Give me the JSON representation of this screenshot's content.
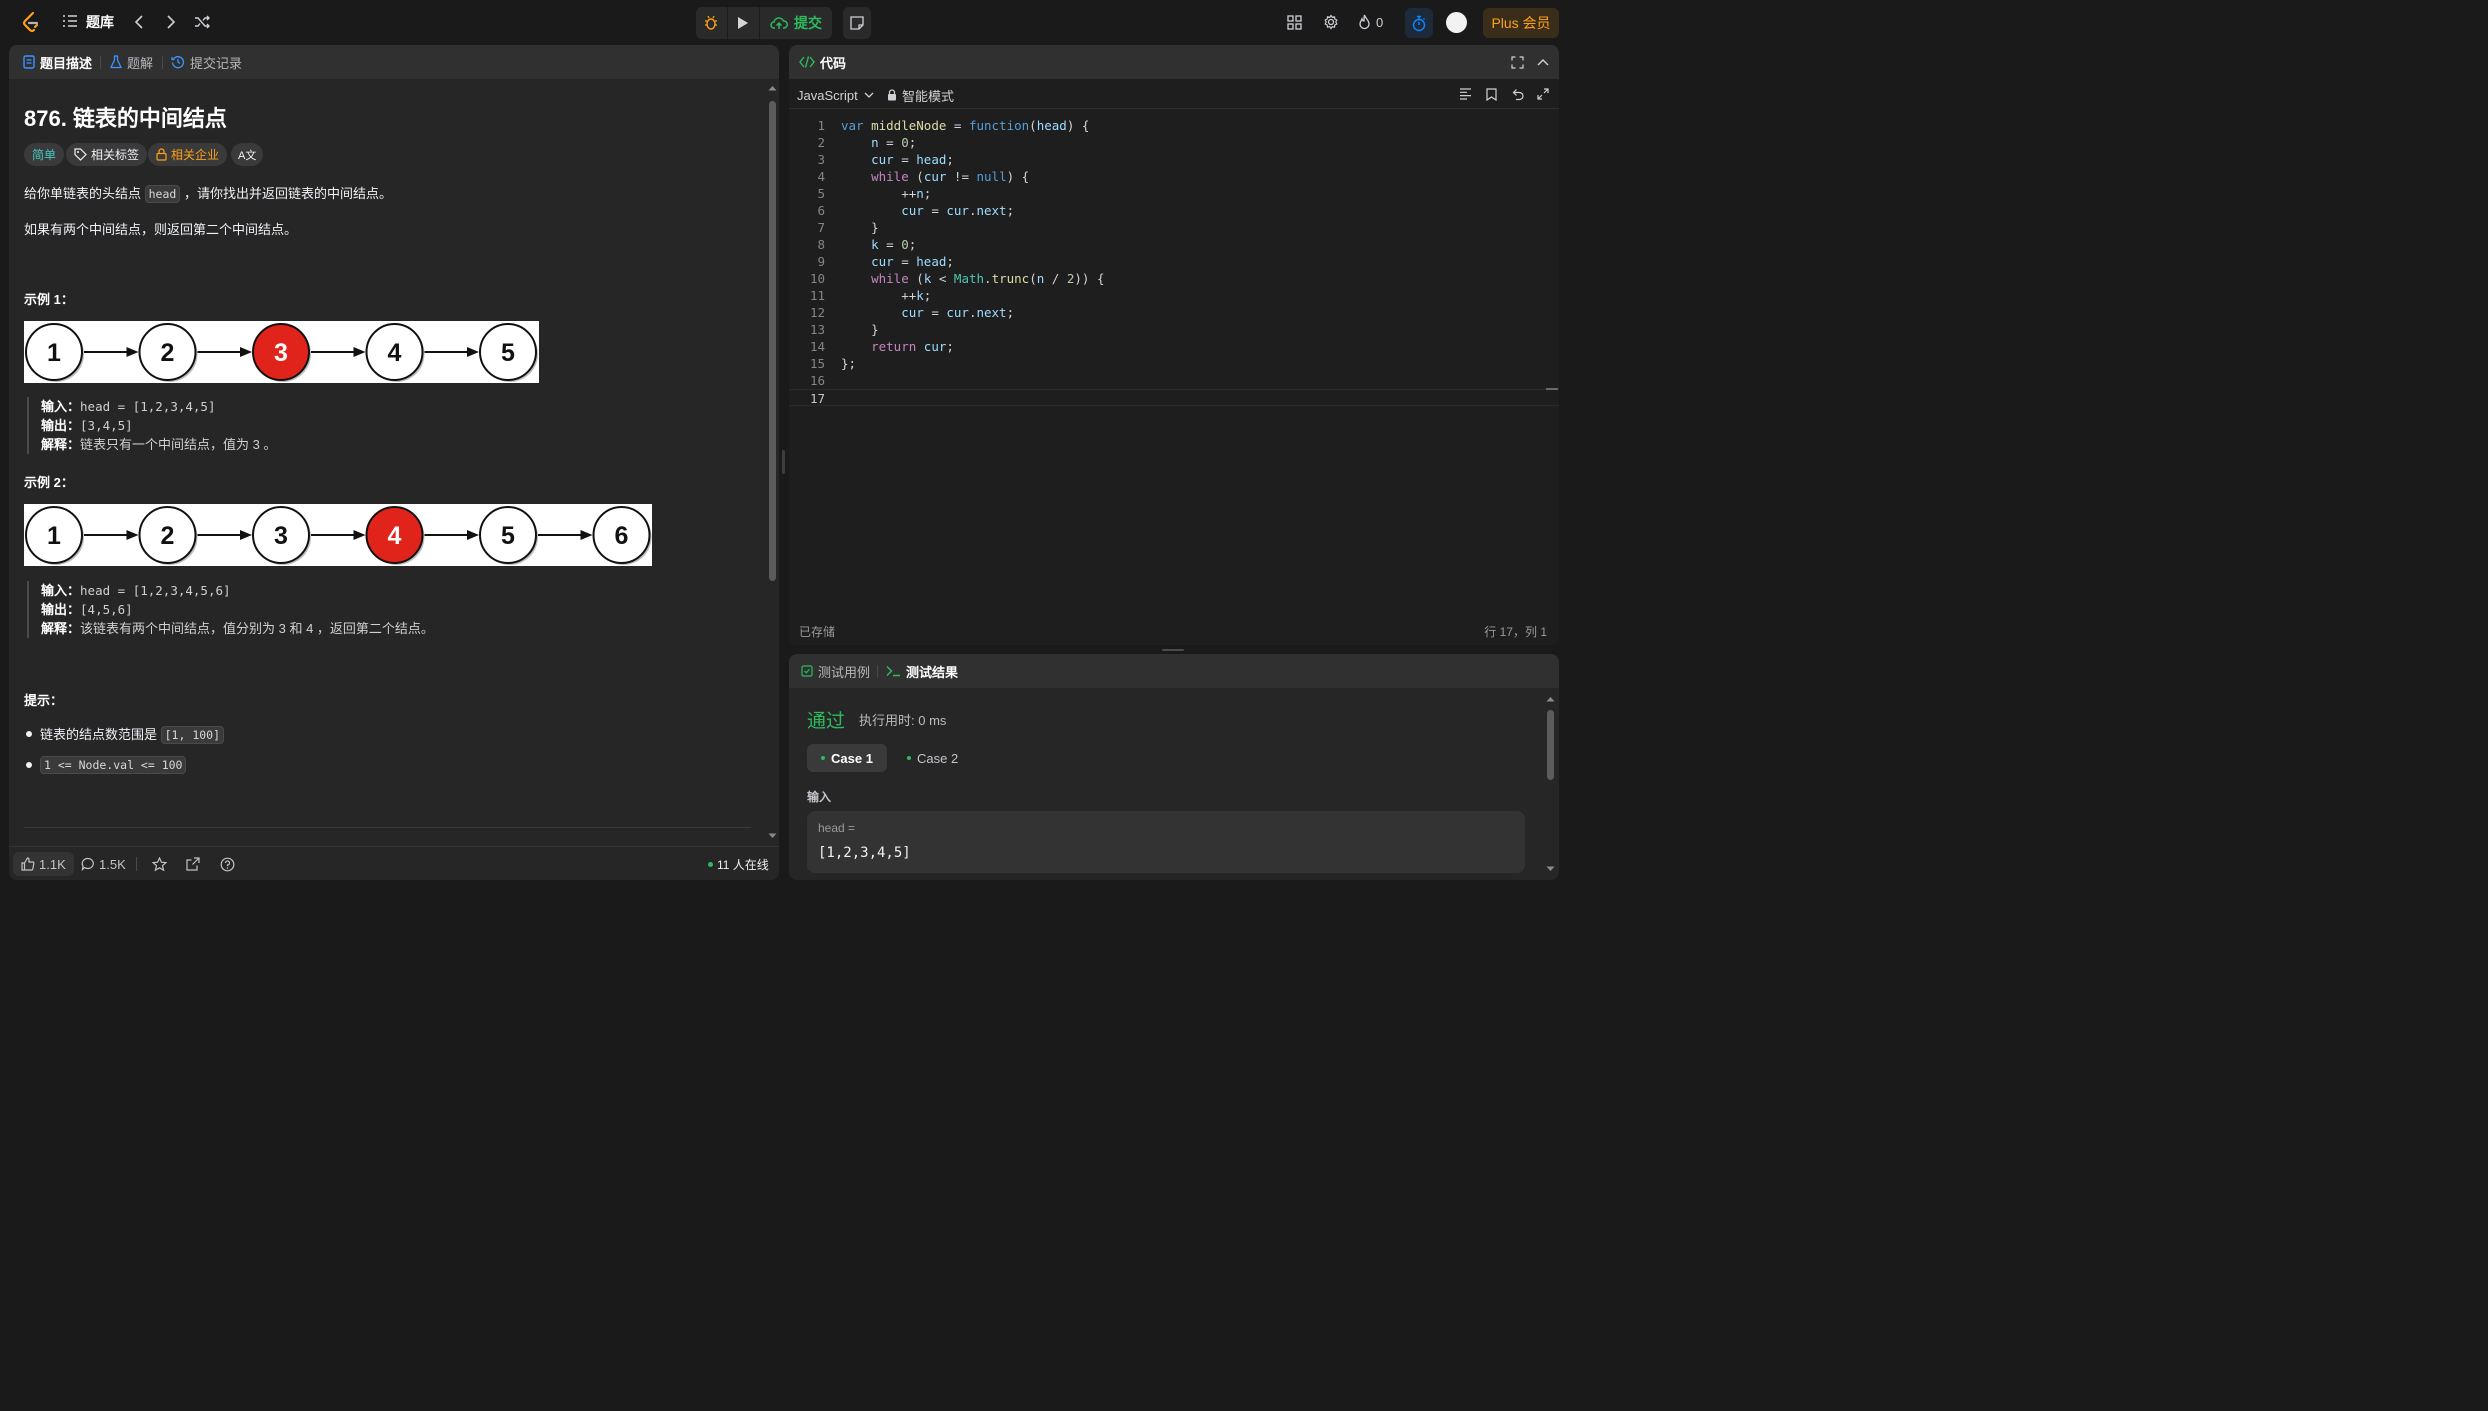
{
  "topbar": {
    "problem_bank": "题库",
    "submit": "提交",
    "streak": "0",
    "plus": "Plus 会员"
  },
  "left_tabs": [
    "题目描述",
    "题解",
    "提交记录"
  ],
  "problem": {
    "title": "876. 链表的中间结点",
    "tags": {
      "difficulty": "简单",
      "related_tags": "相关标签",
      "companies": "相关企业",
      "translate": "A文"
    },
    "desc_part1": "给你单链表的头结点 ",
    "desc_code": "head",
    "desc_part2": " ，请你找出并返回链表的中间结点。",
    "desc2": "如果有两个中间结点，则返回第二个中间结点。",
    "example1": {
      "heading": "示例 1：",
      "nodes": [
        "1",
        "2",
        "3",
        "4",
        "5"
      ],
      "highlight_index": 2,
      "input_label": "输入：",
      "input": "head = [1,2,3,4,5]",
      "output_label": "输出：",
      "output": "[3,4,5]",
      "expl_label": "解释：",
      "expl": "链表只有一个中间结点，值为 3 。"
    },
    "example2": {
      "heading": "示例 2：",
      "nodes": [
        "1",
        "2",
        "3",
        "4",
        "5",
        "6"
      ],
      "highlight_index": 3,
      "input_label": "输入：",
      "input": "head = [1,2,3,4,5,6]",
      "output_label": "输出：",
      "output": "[4,5,6]",
      "expl_label": "解释：",
      "expl": "该链表有两个中间结点，值分别为 3 和 4 ，返回第二个结点。"
    },
    "hints_heading": "提示：",
    "hint1_text": "链表的结点数范围是 ",
    "hint1_code": "[1, 100]",
    "hint2_code": "1 <= Node.val <= 100"
  },
  "left_footer": {
    "likes": "1.1K",
    "comments": "1.5K",
    "online": "11 人在线"
  },
  "code_panel": {
    "title": "代码",
    "language": "JavaScript",
    "mode": "智能模式",
    "saved": "已存储",
    "cursor": "行 17，列 1",
    "line_numbers": [
      "1",
      "2",
      "3",
      "4",
      "5",
      "6",
      "7",
      "8",
      "9",
      "10",
      "11",
      "12",
      "13",
      "14",
      "15",
      "16",
      "17"
    ]
  },
  "result_panel": {
    "tab_cases": "测试用例",
    "tab_result": "测试结果",
    "status": "通过",
    "runtime": "执行用时: 0 ms",
    "case1": "Case 1",
    "case2": "Case 2",
    "input_label": "输入",
    "param_name": "head =",
    "param_value": "[1,2,3,4,5]"
  },
  "colors": {
    "accent": "#ffa116",
    "pass": "#2cbb5d",
    "node_highlight": "#e0231b",
    "blue": "#0a84ff"
  }
}
